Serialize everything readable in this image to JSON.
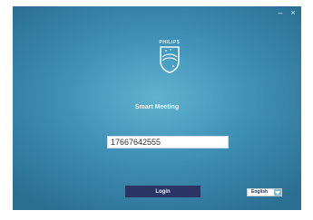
{
  "window": {
    "minimize_symbol": "–",
    "close_symbol": "×"
  },
  "logo": {
    "brand": "PHILIPS",
    "icon": "philips-shield-icon"
  },
  "app": {
    "title": "Smart Meeting"
  },
  "login_form": {
    "phone_value": "17667642555",
    "login_label": "Login",
    "language_selected": "English"
  },
  "colors": {
    "background_center": "#5fb3cf",
    "background_edge": "#2b6f93",
    "login_button": "#2a3566"
  }
}
